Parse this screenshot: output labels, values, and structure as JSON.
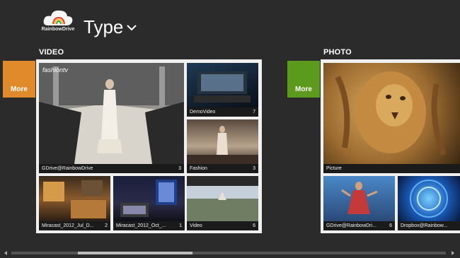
{
  "header": {
    "logo_text": "RainbowDrive",
    "title": "Type"
  },
  "sections": {
    "video": {
      "label": "VIDEO",
      "more_label": "More",
      "tiles": [
        {
          "name": "GDrive@RainbowDrive",
          "count": "3"
        },
        {
          "name": "DemoVideo",
          "count": "7"
        },
        {
          "name": "Fashion",
          "count": "3"
        },
        {
          "name": "Miracast_2012_Jul_D...",
          "count": "2"
        },
        {
          "name": "Miracast_2012_Oct_...",
          "count": "1"
        },
        {
          "name": "Video",
          "count": "6"
        }
      ],
      "thumb_text": "fashiontv"
    },
    "photo": {
      "label": "PHOTO",
      "more_label": "More",
      "tiles": [
        {
          "name": "Picture",
          "count": ""
        },
        {
          "name": "GDrive@RainbowDri...",
          "count": "6"
        },
        {
          "name": "Dropbox@Rainbow...",
          "count": ""
        }
      ]
    }
  },
  "colors": {
    "background": "#2b2b2b",
    "video_more": "#e08a2c",
    "photo_more": "#5c9a1e"
  }
}
